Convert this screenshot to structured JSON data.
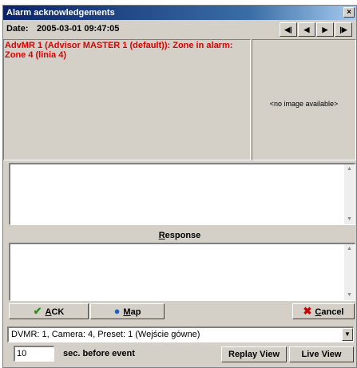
{
  "window": {
    "title": "Alarm acknowledgements",
    "close_glyph": "×"
  },
  "header": {
    "date_label": "Date:",
    "date_value": "2005-03-01 09:47:05",
    "nav": [
      "first-icon",
      "prev-icon",
      "next-icon",
      "last-icon"
    ]
  },
  "alarm": {
    "text": "AdvMR 1 (Advisor MASTER 1 (default)): Zone in alarm: Zone 4 (linia 4)",
    "color": "#e00000"
  },
  "image_panel": {
    "text": "<no image available>"
  },
  "response": {
    "label_prefix": "",
    "label_accel": "R",
    "label_rest": "esponse"
  },
  "buttons": {
    "ack_accel": "A",
    "ack_rest": "CK",
    "map_accel": "M",
    "map_rest": "ap",
    "cancel_accel": "C",
    "cancel_rest": "ancel",
    "replay": "Replay View",
    "live": "Live View"
  },
  "camera_select": {
    "value": "DVMR: 1, Camera: 4, Preset: 1 (Wejście gówne)"
  },
  "seconds": {
    "value": "10",
    "label": "sec. before event"
  },
  "colors": {
    "title_start": "#0a246a",
    "ack_icon": "#2e8b1e",
    "cancel_icon": "#cc0000",
    "map_icon": "#1f5fbf"
  }
}
